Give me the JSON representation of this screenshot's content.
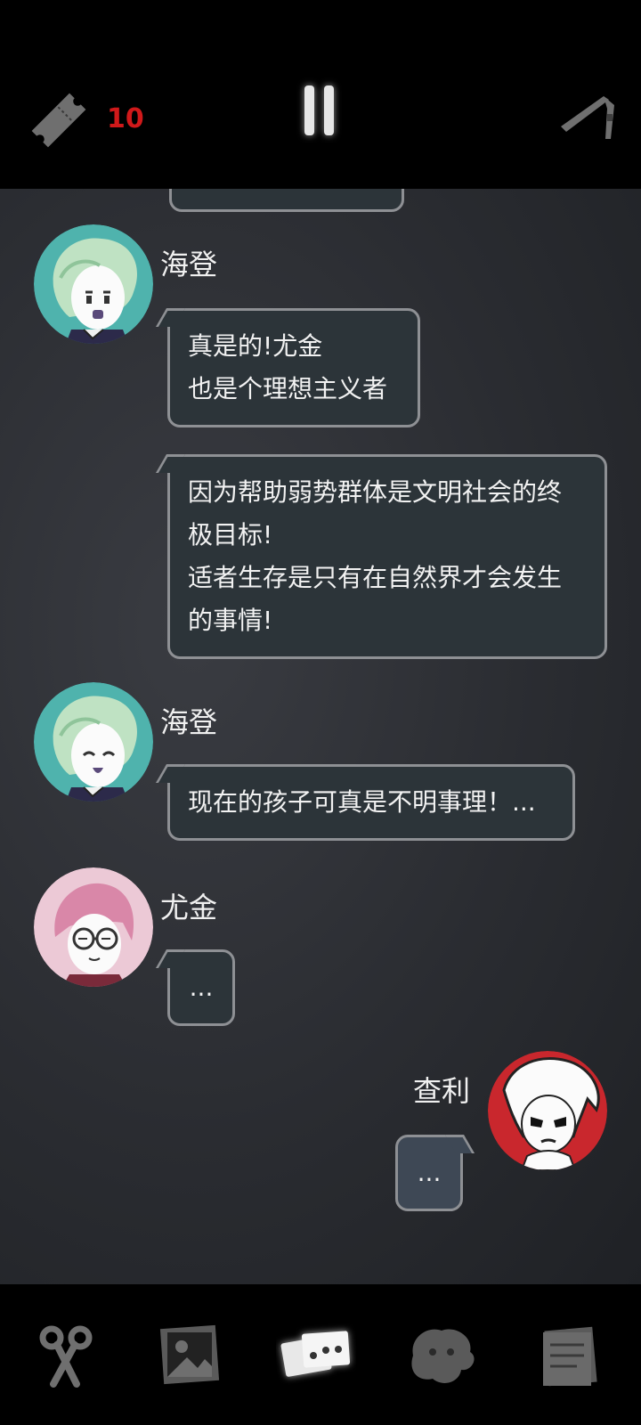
{
  "topbar": {
    "ticket_count": "10",
    "ticket_icon": "ticket-icon",
    "pause_icon": "pause-icon",
    "tool_icon": "tweezers-icon"
  },
  "chat": {
    "messages": [
      {
        "speaker": "海登",
        "lines": [
          "真是的!尤金",
          "也是个理想主义者"
        ]
      },
      {
        "speaker": "海登",
        "lines": [
          "因为帮助弱势群体是文明社会的终",
          "极目标!",
          "适者生存是只有在自然界才会发生",
          "的事情!"
        ]
      },
      {
        "speaker": "海登",
        "lines": [
          "现在的孩子可真是不明事理！..."
        ]
      },
      {
        "speaker": "尤金",
        "lines": [
          "..."
        ]
      },
      {
        "speaker": "查利",
        "lines": [
          "..."
        ]
      }
    ]
  },
  "bottombar": {
    "items": [
      {
        "icon": "scissors-icon"
      },
      {
        "icon": "photo-icon"
      },
      {
        "icon": "chat-cards-icon",
        "active": true
      },
      {
        "icon": "creature-icon"
      },
      {
        "icon": "documents-icon"
      }
    ]
  },
  "colors": {
    "ticket_count": "#d0191a",
    "bubble_bg": "#2c3439",
    "own_bubble_bg": "#3e4855",
    "bubble_border": "#8e9094",
    "hayden_avatar_bg": "#4fb3ad",
    "eugene_avatar_bg": "#ecc9d6",
    "charlie_avatar_bg": "#c9272d"
  }
}
